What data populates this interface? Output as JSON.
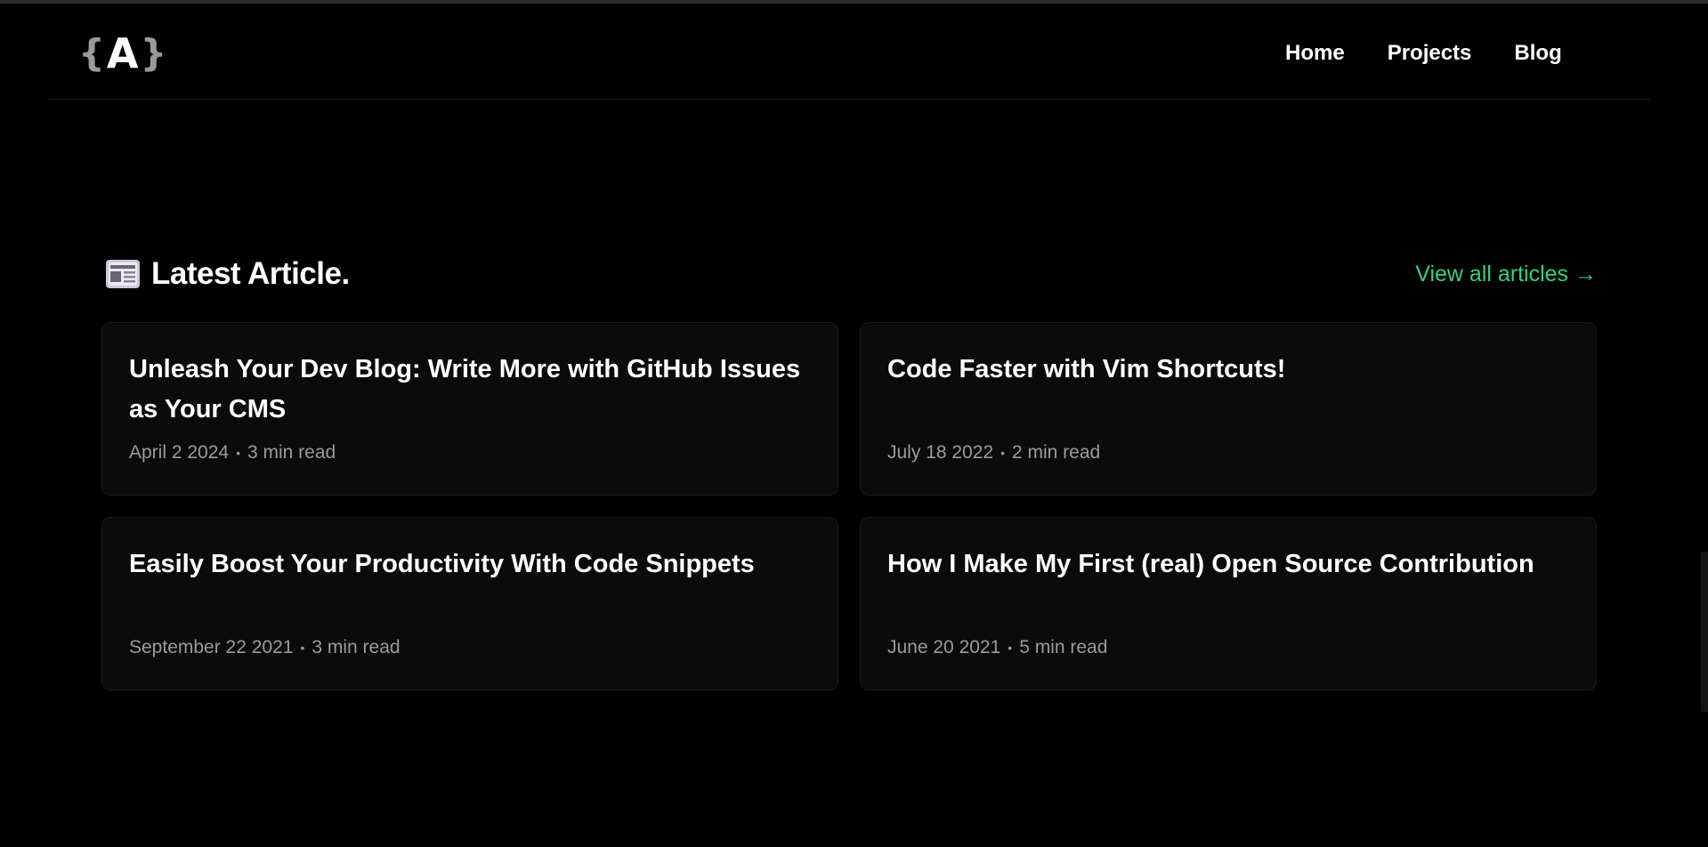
{
  "header": {
    "logo": {
      "brace_open": "{",
      "letter": "A",
      "brace_close": "}"
    },
    "nav": [
      "Home",
      "Projects",
      "Blog"
    ]
  },
  "section": {
    "icon": "newspaper-icon",
    "title": "Latest Article.",
    "view_all": "View all articles →"
  },
  "articles": [
    {
      "title": "Unleash Your Dev Blog: Write More with GitHub Issues as Your CMS",
      "date": "April 2 2024",
      "read": "3 min read"
    },
    {
      "title": "Code Faster with Vim Shortcuts!",
      "date": "July 18 2022",
      "read": "2 min read"
    },
    {
      "title": "Easily Boost Your Productivity With Code Snippets",
      "date": "September 22 2021",
      "read": "3 min read"
    },
    {
      "title": "How I Make My First (real) Open Source Contribution",
      "date": "June 20 2021",
      "read": "5 min read"
    }
  ],
  "colors": {
    "background": "#000000",
    "card": "#0b0b0b",
    "accent": "#34d07f",
    "meta_text": "#9b9b9b"
  }
}
